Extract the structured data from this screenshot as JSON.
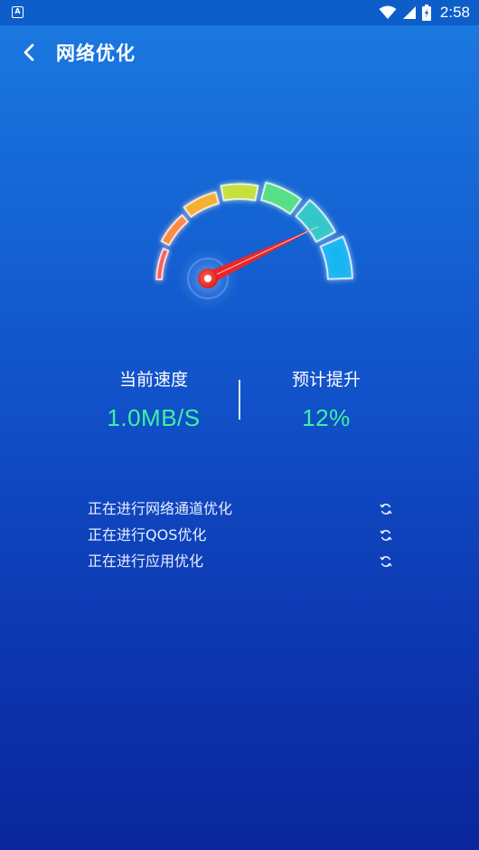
{
  "status_bar": {
    "time": "2:58",
    "icons": [
      "app-a-icon",
      "wifi-icon",
      "cell-signal-icon",
      "battery-icon"
    ]
  },
  "header": {
    "title": "网络优化",
    "back_icon": "chevron-left-icon"
  },
  "gauge": {
    "level": 0.86,
    "colors": [
      "#ff5a52",
      "#ff8a3c",
      "#f6b02a",
      "#c7e23a",
      "#57e089",
      "#33c9c9",
      "#19b6f2"
    ]
  },
  "stats": {
    "current_speed": {
      "label": "当前速度",
      "value": "1.0MB/S"
    },
    "expected_boost": {
      "label": "预计提升",
      "value": "12%"
    }
  },
  "tasks": [
    {
      "text": "正在进行网络通道优化",
      "icon": "refresh-icon"
    },
    {
      "text": "正在进行QOS优化",
      "icon": "refresh-icon"
    },
    {
      "text": "正在进行应用优化",
      "icon": "refresh-icon"
    }
  ]
}
